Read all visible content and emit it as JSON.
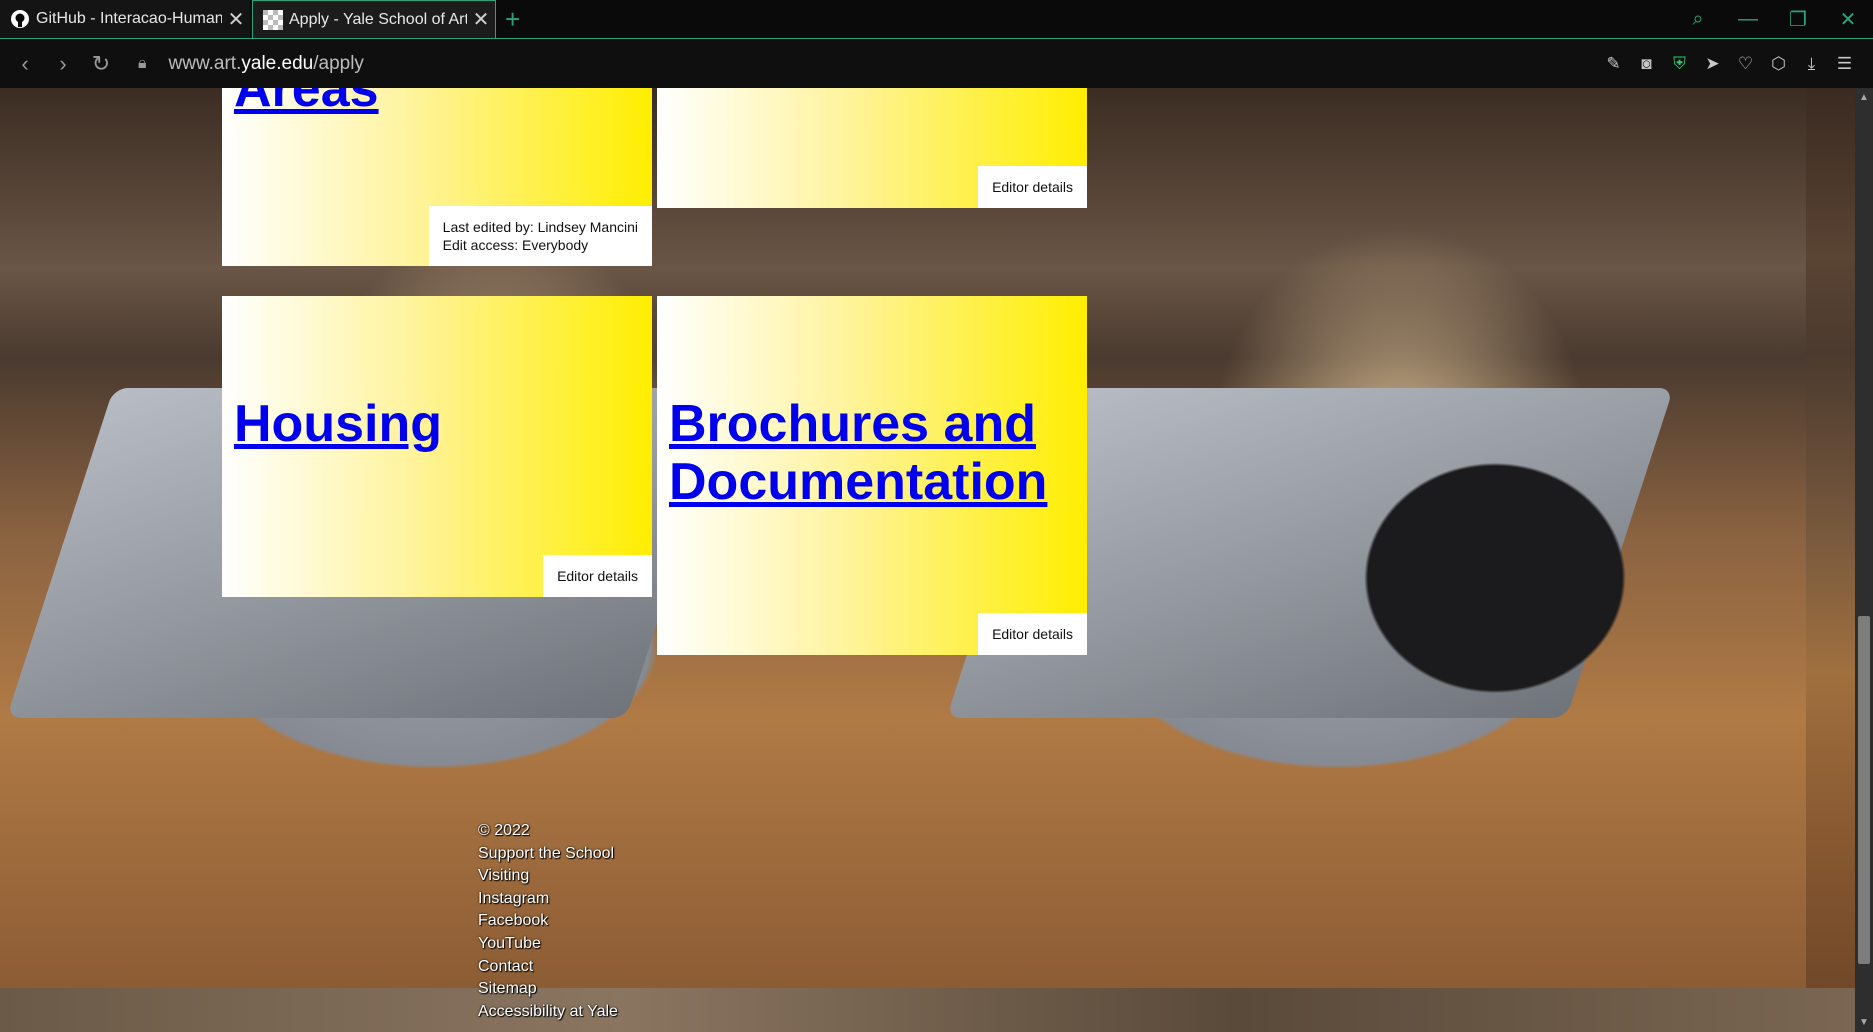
{
  "browser": {
    "tabs": [
      {
        "title": "GitHub - Interacao-Human",
        "active": false
      },
      {
        "title": "Apply - Yale School of Art",
        "active": true
      }
    ],
    "url_prefix": "www.art.",
    "url_host": "yale.edu",
    "url_path": "/apply",
    "accent_color": "#2aa37a"
  },
  "cards": {
    "areas": {
      "title": "Areas",
      "last_edited": "Last edited by: Lindsey Mancini",
      "edit_access": "Edit access: Everybody"
    },
    "top_right": {
      "editor_label": "Editor details"
    },
    "housing": {
      "title": "Housing",
      "editor_label": "Editor details"
    },
    "brochures": {
      "title": "Brochures and Documentation",
      "editor_label": "Editor details"
    }
  },
  "footer": {
    "copyright": "© 2022",
    "links": [
      "Support the School",
      "Visiting",
      "Instagram",
      "Facebook",
      "YouTube",
      "Contact",
      "Sitemap",
      "Accessibility at Yale"
    ]
  },
  "colors": {
    "card_gradient_start": "#ffffff",
    "card_gradient_end": "#ffee00",
    "link_blue": "#0000ee"
  }
}
